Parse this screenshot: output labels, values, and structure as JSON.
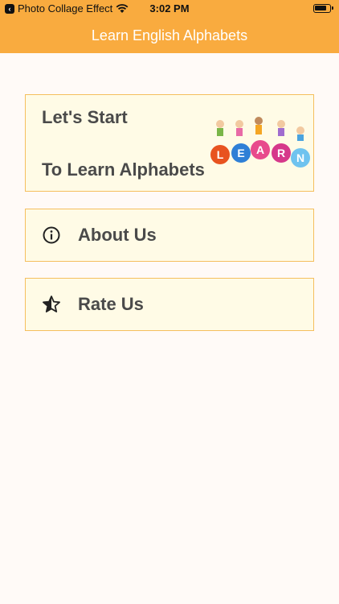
{
  "status": {
    "back_app": "Photo Collage Effect",
    "time": "3:02 PM"
  },
  "nav": {
    "title": "Learn English Alphabets"
  },
  "menu": {
    "start_line1": "Let's Start",
    "start_line2": "To Learn Alphabets",
    "learn_letters": [
      "L",
      "E",
      "A",
      "R",
      "N"
    ],
    "about_label": "About Us",
    "rate_label": "Rate Us"
  },
  "icons": {
    "about": "info-icon",
    "rate": "star-half-icon"
  },
  "colors": {
    "accent": "#f9ab3f",
    "card_bg": "#fffbe6",
    "card_border": "#f5bf5e"
  }
}
